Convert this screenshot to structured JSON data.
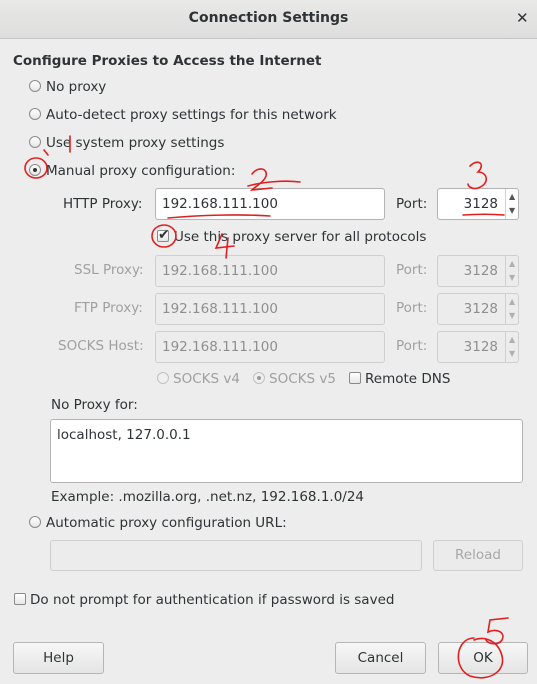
{
  "window": {
    "title": "Connection Settings",
    "close_glyph": "✕"
  },
  "heading": "Configure Proxies to Access the Internet",
  "proxy_mode": {
    "options": [
      {
        "label": "No proxy",
        "selected": false
      },
      {
        "label": "Auto-detect proxy settings for this network",
        "selected": false
      },
      {
        "label": "Use system proxy settings",
        "selected": false
      },
      {
        "label": "Manual proxy configuration:",
        "selected": true
      }
    ]
  },
  "http": {
    "label": "HTTP Proxy:",
    "value": "192.168.111.100",
    "port_label": "Port:",
    "port": "3128"
  },
  "use_all": {
    "label": "Use this proxy server for all protocols",
    "checked": true
  },
  "ssl": {
    "label": "SSL Proxy:",
    "value": "192.168.111.100",
    "port_label": "Port:",
    "port": "3128"
  },
  "ftp": {
    "label": "FTP Proxy:",
    "value": "192.168.111.100",
    "port_label": "Port:",
    "port": "3128"
  },
  "socks": {
    "label": "SOCKS Host:",
    "value": "192.168.111.100",
    "port_label": "Port:",
    "port": "3128"
  },
  "socks_version": {
    "v4": "SOCKS v4",
    "v5": "SOCKS v5",
    "selected": "v5",
    "remote_dns": "Remote DNS"
  },
  "no_proxy": {
    "label": "No Proxy for:",
    "value": "localhost, 127.0.0.1",
    "example": "Example: .mozilla.org, .net.nz, 192.168.1.0/24"
  },
  "auto_config": {
    "label": "Automatic proxy configuration URL:",
    "value": "",
    "reload": "Reload"
  },
  "no_auth_prompt": {
    "label": "Do not prompt for authentication if password is saved",
    "checked": false
  },
  "buttons": {
    "help": "Help",
    "cancel": "Cancel",
    "ok": "OK"
  },
  "annotations": [
    "2",
    "3",
    "4",
    "5"
  ],
  "colors": {
    "annotation": "#e02020",
    "window_bg": "#ededed"
  }
}
